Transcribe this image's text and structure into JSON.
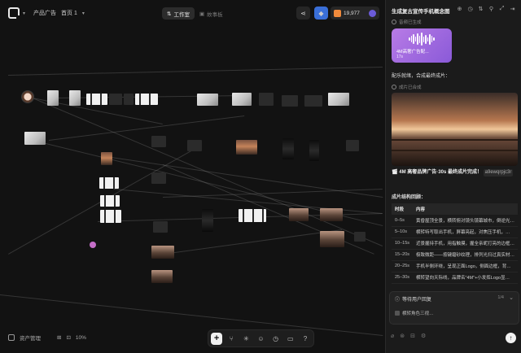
{
  "topbar": {
    "project": "产品广告",
    "breadcrumb": "首页 1",
    "tab_workspace": "工作室",
    "tab_storyboard": "故事板",
    "credits": "19,977",
    "credits_icon": "diamond-icon"
  },
  "canvas": {
    "zoom": "10%",
    "assets_label": "资产管理",
    "dock_icons": [
      "plus-icon",
      "share-icon",
      "network-icon",
      "user-icon",
      "history-icon",
      "message-icon",
      "help-icon"
    ]
  },
  "panel": {
    "title": "生成复古宣传手机概念图",
    "status_audio": "音频已生成",
    "audio_label": "4M高奢广告配...",
    "audio_duration": "17s",
    "compose_text": "配乐就绪，合成最终成片：",
    "status_video": "成片已合成",
    "video_title": "4M 高奢品牌广告·30s 最终成片完成！",
    "video_tag": "a9ewqrpjc3r",
    "structure_heading": "成片结构回顾：",
    "table": {
      "headers": [
        "时段",
        "内容"
      ],
      "rows": [
        [
          "0–5s",
          "黄昏屋顶全景，横转俯对镜头镜幕城市，倒逆光…"
        ],
        [
          "5–10s",
          "横转特写取出手机，屏幕亮起，对焦压手机，…"
        ],
        [
          "10–15s",
          "近景握持手机，用指触摸，握全亲昵打亮的边框…"
        ],
        [
          "15–20s",
          "极致微距——按键磨砂纹理，排列光扫过真实材…"
        ],
        [
          "20–25s",
          "手机半侧环绕，呈现正面Logo，侧面边框，背…"
        ],
        [
          "25–30s",
          "横转望向天际线，品牌名\"4M\"+小发挥Logo显…"
        ]
      ]
    },
    "wait_title": "等待用户回复",
    "wait_count": "1/4",
    "wait_item": "横转角色三视…"
  },
  "colors": {
    "accent_audio": "#a86be0",
    "credits_gem": "#f08a3c",
    "background": "#121212"
  }
}
